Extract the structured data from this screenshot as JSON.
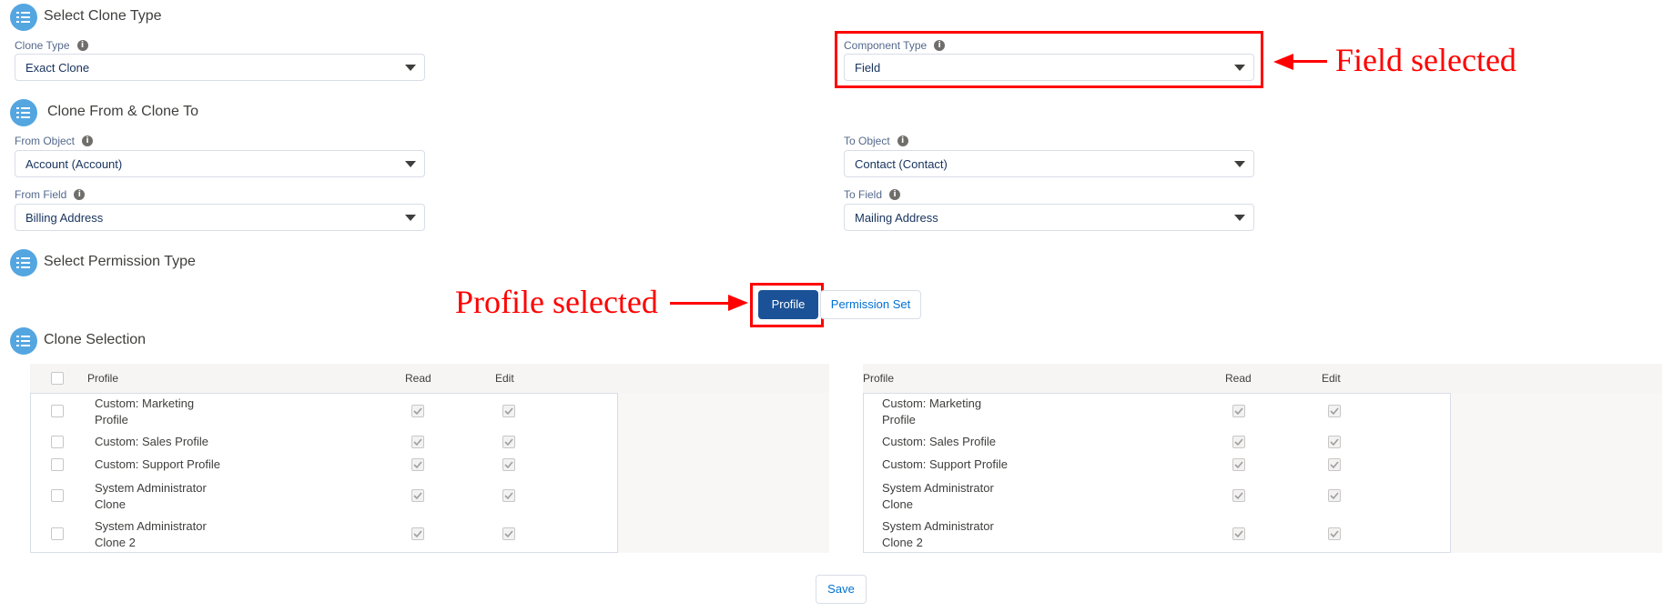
{
  "sections": {
    "clone_type": {
      "title": "Select Clone Type"
    },
    "clone_from_to": {
      "title": "Clone From & Clone To"
    },
    "permission_type": {
      "title": "Select Permission Type"
    },
    "clone_selection": {
      "title": "Clone Selection"
    }
  },
  "fields": {
    "clone_type": {
      "label": "Clone Type",
      "value": "Exact Clone"
    },
    "component_type": {
      "label": "Component Type",
      "value": "Field"
    },
    "from_object": {
      "label": "From Object",
      "value": "Account (Account)"
    },
    "to_object": {
      "label": "To Object",
      "value": "Contact (Contact)"
    },
    "from_field": {
      "label": "From Field",
      "value": "Billing Address"
    },
    "to_field": {
      "label": "To Field",
      "value": "Mailing Address"
    }
  },
  "info_glyph": "i",
  "permission_buttons": {
    "profile": "Profile",
    "permission_set": "Permission Set"
  },
  "annotations": {
    "field_selected": "Field selected",
    "profile_selected": "Profile selected"
  },
  "table": {
    "headers": {
      "profile": "Profile",
      "read": "Read",
      "edit": "Edit"
    },
    "rows": [
      {
        "line1": "Custom: Marketing",
        "line2": "Profile",
        "read": true,
        "edit": true
      },
      {
        "line1": "Custom: Sales Profile",
        "line2": "",
        "read": true,
        "edit": true
      },
      {
        "line1": "Custom: Support Profile",
        "line2": "",
        "read": true,
        "edit": true
      },
      {
        "line1": "System Administrator",
        "line2": "Clone",
        "read": true,
        "edit": true
      },
      {
        "line1": "System Administrator",
        "line2": "Clone 2",
        "read": true,
        "edit": true
      }
    ]
  },
  "save_label": "Save",
  "colors": {
    "brand": "#1b5297",
    "section_icon": "#54a6e0",
    "annotation": "#ff0000",
    "link": "#0070d2"
  },
  "icons": {
    "section": "list-icon",
    "info": "info-icon",
    "select_caret": "chevron-down-icon",
    "checkbox_check": "checkmark-icon"
  }
}
